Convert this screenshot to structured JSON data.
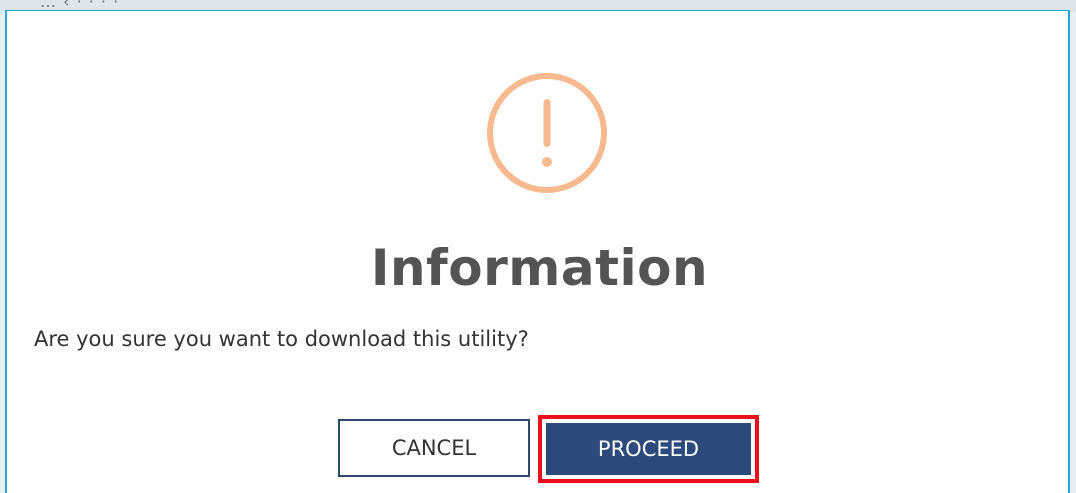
{
  "backdrop": {
    "breadcrumb_text": "…  ‹  ·  ·  ·  ·"
  },
  "dialog": {
    "icon": "exclamation-circle-icon",
    "title": "Information",
    "message": "Are you sure you want to download this utility?",
    "buttons": {
      "cancel_label": "CANCEL",
      "proceed_label": "PROCEED"
    },
    "colors": {
      "icon": "#f7b98d",
      "title": "#545454",
      "proceed_bg": "#2c4a7c",
      "highlight_border": "#e8101a",
      "dialog_border": "#23a8d8"
    }
  }
}
